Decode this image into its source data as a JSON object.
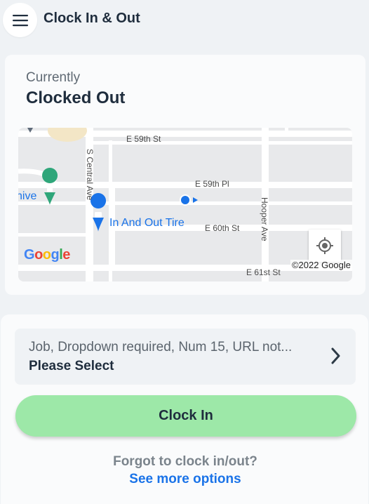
{
  "header": {
    "title": "Clock In & Out",
    "menu_icon": "hamburger-menu-icon"
  },
  "status": {
    "label": "Currently",
    "value": "Clocked Out"
  },
  "map": {
    "streets": {
      "e59th_st": "E 59th St",
      "e59th_pl": "E 59th Pl",
      "e60th_st": "E 60th St",
      "e61st_st": "E 61st St",
      "s_central_ave": "S Central Ave",
      "hooper_ave": "Hooper Ave"
    },
    "places": {
      "tire_shop": "In And Out Tire",
      "partial_label": "hive"
    },
    "logo": "Google",
    "copyright": "©2022 Google",
    "locate_icon": "my-location-icon",
    "colors": {
      "place_marker": "#1a73e8",
      "park_marker": "#2fa67a",
      "place_text": "#1a73e8"
    }
  },
  "job": {
    "label": "Job, Dropdown required, Num 15, URL not...",
    "value": "Please Select",
    "chevron_icon": "chevron-right-icon"
  },
  "clock_button": {
    "label": "Clock In",
    "color": "#9de8a8"
  },
  "footer": {
    "forgot_text": "Forgot to clock in/out?",
    "see_more": "See more options",
    "link_color": "#1a73e8"
  }
}
